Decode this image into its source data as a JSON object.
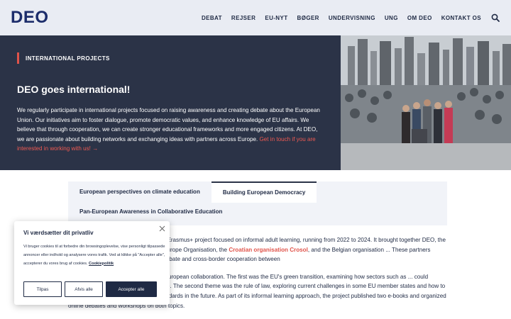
{
  "header": {
    "logo": "DEO",
    "nav": [
      "DEBAT",
      "REJSER",
      "EU-NYT",
      "BØGER",
      "UNDERVISNING",
      "UNG",
      "OM DEO",
      "KONTAKT OS"
    ],
    "search_icon": "search-icon"
  },
  "hero": {
    "eyebrow": "INTERNATIONAL PROJECTS",
    "title": "DEO goes international!",
    "body": "We regularly participate in international projects focused on raising awareness and creating debate about the European Union. Our initiatives aim to foster dialogue, promote democratic values, and enhance knowledge of EU affairs. We believe that through cooperation, we can create stronger educational frameworks and more engaged citizens. At DEO, we are passionate about building networks and exchanging ideas with partners across Europe.",
    "cta": "Get in touch if you are interested in working with us! →"
  },
  "tabs": {
    "items": [
      "European perspectives on climate education",
      "Building European Democracy"
    ],
    "active_index": 1,
    "second_row": "Pan-European Awareness in Collaborative Education"
  },
  "article": {
    "p1_a": "Building European Democracy was an Erasmus+ project focused on informal adult learning, running from 2022 to 2024. It brought together DEO, the Hungarian Foundation Democracy in Europe Organisation, the ",
    "p1_link": "Croatian organisation Crosol",
    "p1_b": ", and the Belgian organisation ... These partners collaborated to strengthen European debate and cross-border cooperation between",
    "p2": "The project centred on two themes in European collaboration. The first was the EU's green transition, examining how sectors such as ... could contribute to a more sustainable Europe. The second theme was the rule of law, exploring current challenges in some EU member states and how to better uphold legal and democratic standards in the future. As part of its informal learning approach, the project published two e-books and organized online debates and workshops on both topics."
  },
  "cookie": {
    "title": "Vi værdsætter dit privatliv",
    "text": "Vi bruger cookies til at forbedre din browsingoplevelse, vise personligt tilpassede annoncer eller indhold og analysere vores trafik. Ved at klikke på \"Accepter alle\", accepterer du vores brug af cookies.",
    "policy_link": "Cookiepolitik",
    "btn_customize": "Tilpas",
    "btn_reject": "Afvis alle",
    "btn_accept": "Accepter alle"
  },
  "colors": {
    "brand": "#1c2d6b",
    "hero_bg": "#2b3347",
    "accent": "#e0534a"
  }
}
